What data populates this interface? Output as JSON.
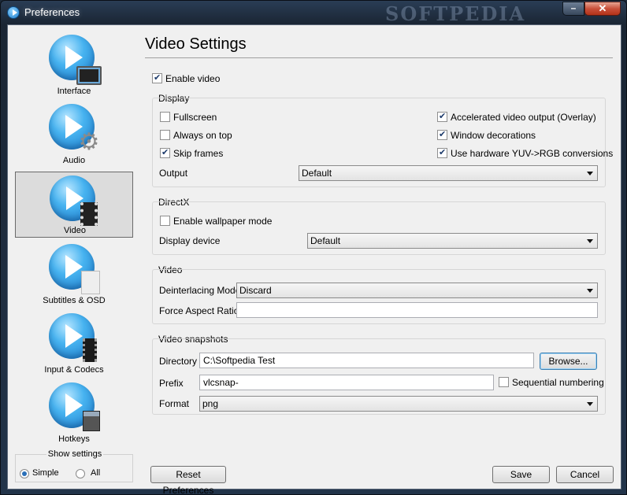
{
  "window": {
    "title": "Preferences",
    "watermark": "SOFTPEDIA",
    "close_label": "✕",
    "min_label": "–"
  },
  "sidebar": {
    "items": [
      {
        "label": "Interface",
        "icon": "monitor-icon"
      },
      {
        "label": "Audio",
        "icon": "gear-icon"
      },
      {
        "label": "Video",
        "icon": "film-icon",
        "selected": true
      },
      {
        "label": "Subtitles & OSD",
        "icon": "document-icon"
      },
      {
        "label": "Input & Codecs",
        "icon": "chip-icon"
      },
      {
        "label": "Hotkeys",
        "icon": "keypad-icon"
      }
    ],
    "show_settings": {
      "title": "Show settings",
      "simple": "Simple",
      "all": "All",
      "selected": "Simple"
    }
  },
  "main": {
    "title": "Video Settings",
    "enable_video": {
      "label": "Enable video",
      "checked": true
    },
    "display": {
      "title": "Display",
      "fullscreen": {
        "label": "Fullscreen",
        "checked": false
      },
      "always_on_top": {
        "label": "Always on top",
        "checked": false
      },
      "skip_frames": {
        "label": "Skip frames",
        "checked": true
      },
      "accelerated": {
        "label": "Accelerated video output (Overlay)",
        "checked": true
      },
      "window_decorations": {
        "label": "Window decorations",
        "checked": true
      },
      "hardware_yuv": {
        "label": "Use hardware YUV->RGB conversions",
        "checked": true
      },
      "output_label": "Output",
      "output_value": "Default"
    },
    "directx": {
      "title": "DirectX",
      "wallpaper": {
        "label": "Enable wallpaper mode",
        "checked": false
      },
      "device_label": "Display device",
      "device_value": "Default"
    },
    "video": {
      "title": "Video",
      "deinterlace_label": "Deinterlacing Mode",
      "deinterlace_value": "Discard",
      "aspect_label": "Force Aspect Ratio",
      "aspect_value": ""
    },
    "snapshots": {
      "title": "Video snapshots",
      "directory_label": "Directory",
      "directory_value": "C:\\Softpedia Test",
      "browse_label": "Browse...",
      "prefix_label": "Prefix",
      "prefix_value": "vlcsnap-",
      "sequential": {
        "label": "Sequential numbering",
        "checked": false
      },
      "format_label": "Format",
      "format_value": "png"
    }
  },
  "footer": {
    "reset_label": "Reset Preferences",
    "save_label": "Save",
    "cancel_label": "Cancel"
  }
}
